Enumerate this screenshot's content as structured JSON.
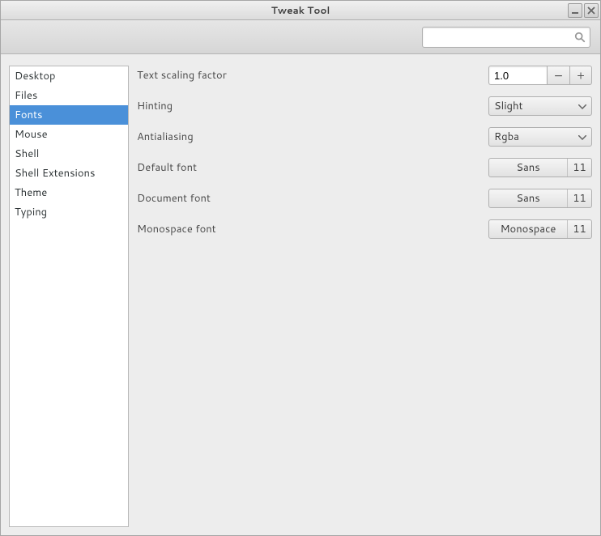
{
  "window": {
    "title": "Tweak Tool"
  },
  "search": {
    "placeholder": ""
  },
  "sidebar": {
    "items": [
      {
        "label": "Desktop",
        "selected": false
      },
      {
        "label": "Files",
        "selected": false
      },
      {
        "label": "Fonts",
        "selected": true
      },
      {
        "label": "Mouse",
        "selected": false
      },
      {
        "label": "Shell",
        "selected": false
      },
      {
        "label": "Shell Extensions",
        "selected": false
      },
      {
        "label": "Theme",
        "selected": false
      },
      {
        "label": "Typing",
        "selected": false
      }
    ]
  },
  "settings": {
    "text_scaling": {
      "label": "Text scaling factor",
      "value": "1.0"
    },
    "hinting": {
      "label": "Hinting",
      "value": "Slight"
    },
    "antialiasing": {
      "label": "Antialiasing",
      "value": "Rgba"
    },
    "default_font": {
      "label": "Default font",
      "name": "Sans",
      "size": "11"
    },
    "document_font": {
      "label": "Document font",
      "name": "Sans",
      "size": "11"
    },
    "monospace_font": {
      "label": "Monospace font",
      "name": "Monospace",
      "size": "11"
    }
  },
  "glyphs": {
    "minus": "−",
    "plus": "+"
  }
}
